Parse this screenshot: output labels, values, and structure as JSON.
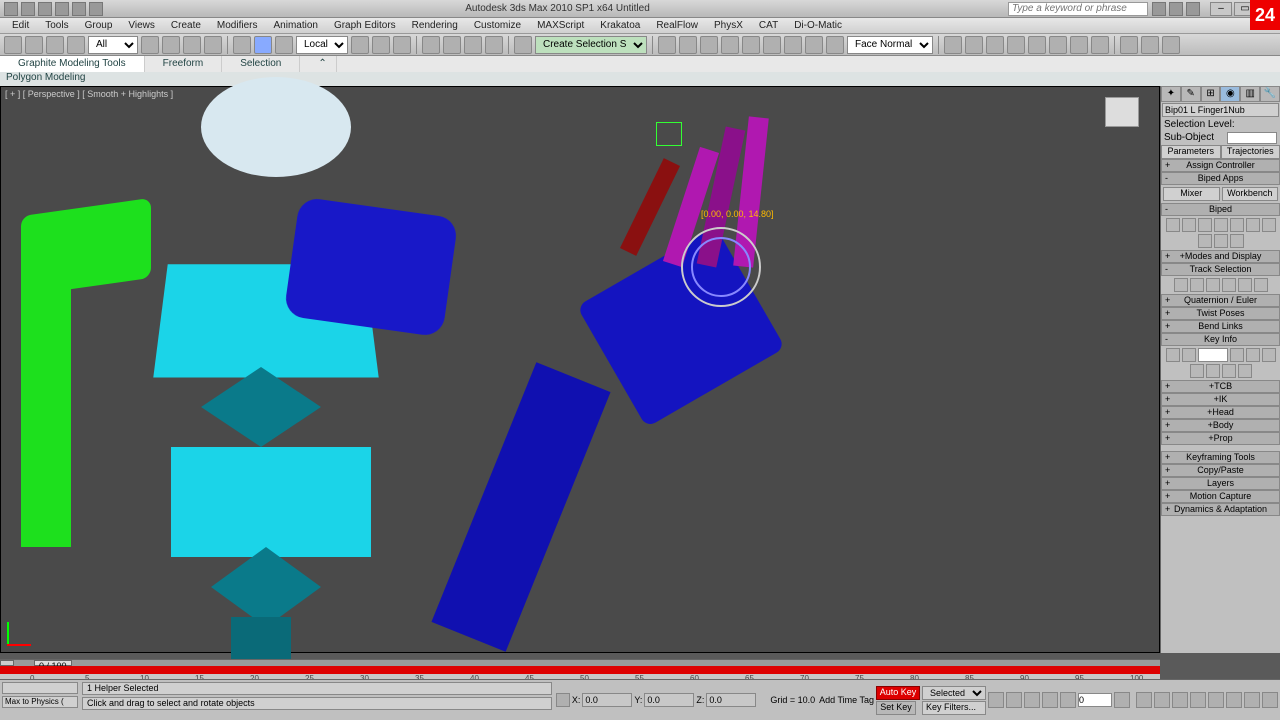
{
  "app": {
    "title": "Autodesk 3ds Max 2010 SP1 x64     Untitled",
    "search_placeholder": "Type a keyword or phrase",
    "clock": "24"
  },
  "menu": [
    "Edit",
    "Tools",
    "Group",
    "Views",
    "Create",
    "Modifiers",
    "Animation",
    "Graph Editors",
    "Rendering",
    "Customize",
    "MAXScript",
    "Krakatoa",
    "RealFlow",
    "PhysX",
    "CAT",
    "Di-O-Matic"
  ],
  "toolbar": {
    "sel_filter": "All",
    "refcoord": "Local",
    "named_sel": "Create Selection S",
    "facenormal": "Face Normal"
  },
  "ribbon": {
    "tabs": [
      "Graphite Modeling Tools",
      "Freeform",
      "Selection"
    ],
    "body": "Polygon Modeling"
  },
  "viewport": {
    "label": "[ + ] [ Perspective ] [ Smooth + Highlights ]",
    "gizmo_readout": "[0.00, 0.00, 14.80]"
  },
  "cmdpanel": {
    "objname": "Bip01 L Finger1Nub",
    "sel_level": "Selection Level:",
    "subobj": "Sub-Object",
    "tabs": [
      "Parameters",
      "Trajectories"
    ],
    "rollouts": {
      "assign": "Assign Controller",
      "apps": "Biped Apps",
      "mixer": "Mixer",
      "workbench": "Workbench",
      "biped": "Biped",
      "modes": "+Modes and Display",
      "track": "Track Selection",
      "quat": "Quaternion / Euler",
      "twist": "Twist Poses",
      "bend": "Bend Links",
      "keyinfo": "Key Info",
      "tcb": "+TCB",
      "ik": "+IK",
      "head": "+Head",
      "body": "+Body",
      "prop": "+Prop",
      "kftools": "Keyframing Tools",
      "copy": "Copy/Paste",
      "layers": "Layers",
      "mocap": "Motion Capture",
      "dyn": "Dynamics & Adaptation"
    }
  },
  "timeline": {
    "frame": "0 / 100",
    "ticks": [
      0,
      5,
      10,
      15,
      20,
      25,
      30,
      35,
      40,
      45,
      50,
      55,
      60,
      65,
      70,
      75,
      80,
      85,
      90,
      95,
      100
    ]
  },
  "status": {
    "script": "Max to Physics (",
    "sel": "1 Helper Selected",
    "prompt": "Click and drag to select and rotate objects",
    "x": "0.0",
    "y": "0.0",
    "z": "0.0",
    "grid": "Grid = 10.0",
    "addtag": "Add Time Tag",
    "autokey": "Auto Key",
    "setkey": "Set Key",
    "keyfilters": "Key Filters...",
    "selected": "Selected"
  }
}
